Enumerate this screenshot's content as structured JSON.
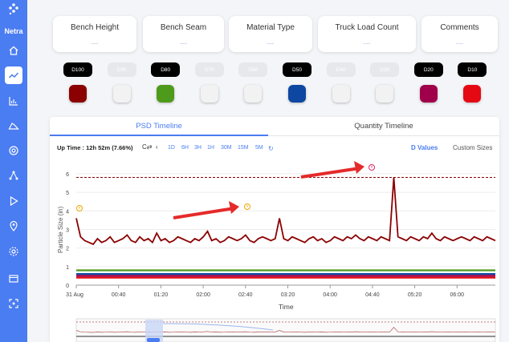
{
  "app": {
    "brand": "Netra"
  },
  "sidebar": {
    "items": [
      {
        "icon": "home-icon"
      },
      {
        "icon": "trend-chart-icon",
        "active": true
      },
      {
        "icon": "bar-chart-icon"
      },
      {
        "icon": "pile-icon"
      },
      {
        "icon": "target-camera-icon"
      },
      {
        "icon": "network-icon"
      },
      {
        "icon": "play-icon"
      },
      {
        "icon": "location-pin-icon"
      },
      {
        "icon": "gear-icon"
      },
      {
        "icon": "media-icon"
      },
      {
        "icon": "scan-icon"
      }
    ]
  },
  "info_cards": [
    {
      "title": "Bench Height",
      "value": "---"
    },
    {
      "title": "Bench Seam",
      "value": "---"
    },
    {
      "title": "Material Type",
      "value": "---"
    },
    {
      "title": "Truck Load Count",
      "value": "---"
    },
    {
      "title": "Comments",
      "value": "---"
    }
  ],
  "d_toggles": [
    {
      "label": "D100",
      "on": true,
      "color": "#8b0000"
    },
    {
      "label": "D90",
      "on": false,
      "color": "#f2f2f2"
    },
    {
      "label": "D80",
      "on": true,
      "color": "#4e9a1a"
    },
    {
      "label": "D70",
      "on": false,
      "color": "#f2f2f2"
    },
    {
      "label": "D60",
      "on": false,
      "color": "#f2f2f2"
    },
    {
      "label": "D50",
      "on": true,
      "color": "#0d47a1"
    },
    {
      "label": "D40",
      "on": false,
      "color": "#f2f2f2"
    },
    {
      "label": "D30",
      "on": false,
      "color": "#f2f2f2"
    },
    {
      "label": "D20",
      "on": true,
      "color": "#a0004a"
    },
    {
      "label": "D10",
      "on": true,
      "color": "#e50914"
    }
  ],
  "tabs": {
    "psd": "PSD Timeline",
    "quantity": "Quantity Timeline"
  },
  "toolbar": {
    "uptime": "Up Time : 12h 52m (7.66%)",
    "ranges": [
      "1D",
      "6H",
      "3H",
      "1H",
      "30M",
      "15M",
      "5M"
    ],
    "d_values": "D Values",
    "custom_sizes": "Custom Sizes"
  },
  "chart_data": {
    "type": "line",
    "ylabel": "Particle Size (in)",
    "xlabel": "Time",
    "ylim": [
      0,
      6.6
    ],
    "yticks": [
      0,
      1,
      2,
      3,
      4,
      5,
      6
    ],
    "xticks": [
      "31 Aug",
      "00:40",
      "01:20",
      "02:00",
      "02:40",
      "03:20",
      "04:00",
      "04:40",
      "05:20",
      "06:00"
    ],
    "threshold": 5.8,
    "series": [
      {
        "color": "#8b0000",
        "values": [
          3.6,
          2.6,
          2.4,
          2.3,
          2.2,
          2.5,
          2.3,
          2.4,
          2.6,
          2.3,
          2.4,
          2.5,
          2.7,
          2.4,
          2.3,
          2.6,
          2.4,
          2.5,
          2.3,
          2.8,
          2.4,
          2.5,
          2.3,
          2.4,
          2.6,
          2.5,
          2.4,
          2.3,
          2.5,
          2.4,
          2.6,
          2.9,
          2.4,
          2.5,
          2.3,
          2.4,
          2.6,
          2.5,
          2.4,
          2.5,
          2.7,
          2.4,
          2.3,
          2.5,
          2.6,
          2.5,
          2.4,
          2.5,
          3.6,
          2.5,
          2.4,
          2.6,
          2.5,
          2.4,
          2.3,
          2.5,
          2.6,
          2.4,
          2.5,
          2.3,
          2.4,
          2.6,
          2.5,
          2.4,
          2.6,
          2.5,
          2.7,
          2.5,
          2.4,
          2.6,
          2.5,
          2.4,
          2.6,
          2.5,
          2.4,
          5.8,
          2.6,
          2.5,
          2.4,
          2.6,
          2.5,
          2.4,
          2.6,
          2.5,
          2.8,
          2.5,
          2.4,
          2.6,
          2.5,
          2.4,
          2.5,
          2.6,
          2.5,
          2.4,
          2.6,
          2.5,
          2.4,
          2.6,
          2.5,
          2.4
        ]
      },
      {
        "color": "#4e9a1a",
        "values": [
          0.8,
          0.8,
          0.8,
          0.8,
          0.8,
          0.8,
          0.8,
          0.8,
          0.8,
          0.8
        ]
      },
      {
        "color": "#0d47a1",
        "values": [
          0.6,
          0.6,
          0.6,
          0.6,
          0.6,
          0.6,
          0.6,
          0.6,
          0.6,
          0.6
        ]
      },
      {
        "color": "#a0004a",
        "values": [
          0.5,
          0.5,
          0.5,
          0.5,
          0.5,
          0.5,
          0.5,
          0.5,
          0.5,
          0.5
        ]
      },
      {
        "color": "#e50914",
        "values": [
          0.4,
          0.4,
          0.4,
          0.4,
          0.4,
          0.4,
          0.4,
          0.4,
          0.4,
          0.4
        ]
      }
    ]
  }
}
